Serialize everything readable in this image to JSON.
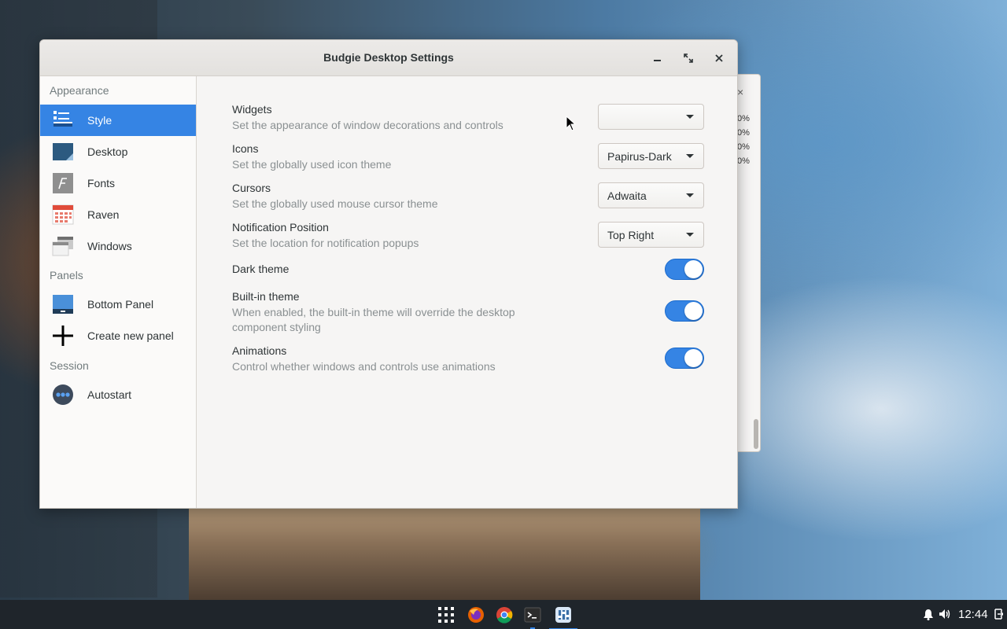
{
  "window": {
    "title": "Budgie Desktop Settings"
  },
  "background_window": {
    "close_glyph": "×",
    "percent_lines": [
      "0%",
      "0%",
      "0%",
      "0%"
    ]
  },
  "sidebar": {
    "sections": [
      {
        "label": "Appearance"
      },
      {
        "label": "Panels"
      },
      {
        "label": "Session"
      }
    ],
    "items": [
      {
        "label": "Style",
        "icon": "style-icon",
        "active": true
      },
      {
        "label": "Desktop",
        "icon": "desktop-icon"
      },
      {
        "label": "Fonts",
        "icon": "fonts-icon"
      },
      {
        "label": "Raven",
        "icon": "raven-calendar-icon"
      },
      {
        "label": "Windows",
        "icon": "windows-icon"
      },
      {
        "label": "Bottom Panel",
        "icon": "bottom-panel-icon"
      },
      {
        "label": "Create new panel",
        "icon": "plus-icon"
      },
      {
        "label": "Autostart",
        "icon": "autostart-icon"
      }
    ]
  },
  "settings": {
    "widgets": {
      "title": "Widgets",
      "desc": "Set the appearance of window decorations and controls",
      "value": ""
    },
    "icons": {
      "title": "Icons",
      "desc": "Set the globally used icon theme",
      "value": "Papirus-Dark"
    },
    "cursors": {
      "title": "Cursors",
      "desc": "Set the globally used mouse cursor theme",
      "value": "Adwaita"
    },
    "notification": {
      "title": "Notification Position",
      "desc": "Set the location for notification popups",
      "value": "Top Right"
    },
    "dark_theme": {
      "title": "Dark theme",
      "enabled": true
    },
    "builtin_theme": {
      "title": "Built-in theme",
      "desc": "When enabled, the built-in theme will override the desktop component styling",
      "enabled": true
    },
    "animations": {
      "title": "Animations",
      "desc": "Control whether windows and controls use animations",
      "enabled": true
    }
  },
  "taskbar": {
    "apps": [
      "app-grid-icon",
      "firefox-icon",
      "chrome-icon",
      "terminal-icon",
      "budgie-settings-icon"
    ],
    "active_app": "budgie-settings-icon",
    "clock": "12:44"
  },
  "colors": {
    "accent": "#3584e4",
    "taskbar": "#1f252b"
  }
}
